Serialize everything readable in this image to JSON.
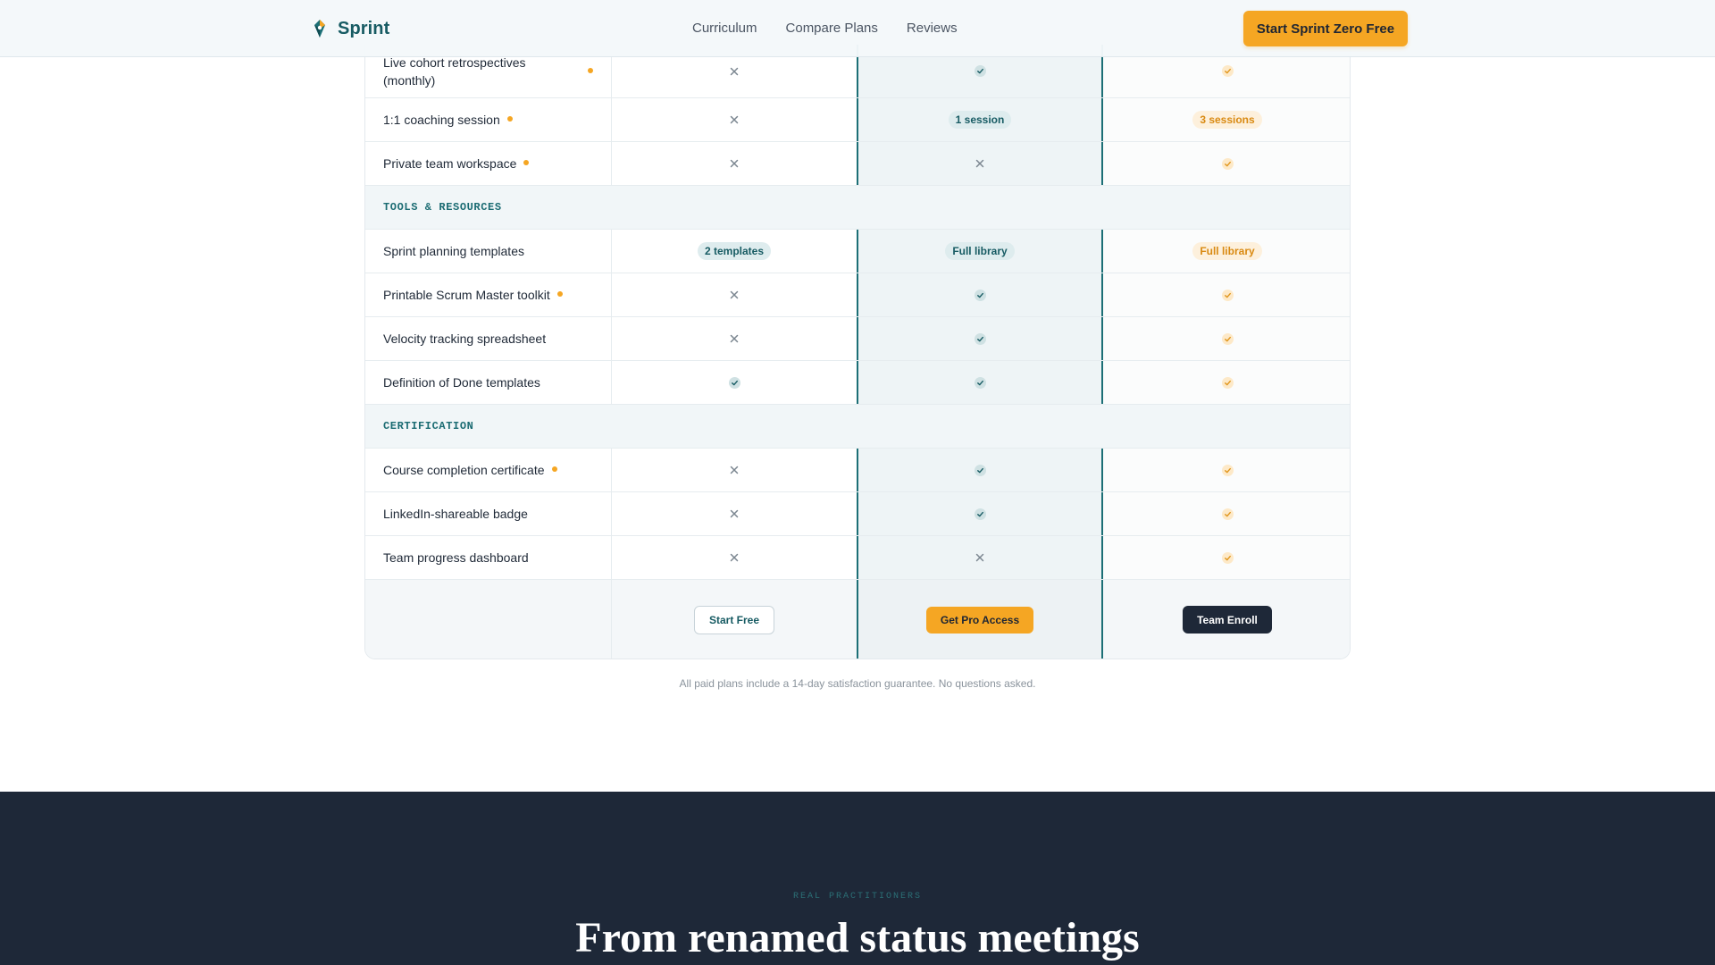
{
  "header": {
    "brand": "Sprint",
    "nav": [
      "Curriculum",
      "Compare Plans",
      "Reviews"
    ],
    "cta": "Start Sprint Zero Free"
  },
  "table": {
    "rows": [
      {
        "type": "feature",
        "label": "Live cohort retrospectives (monthly)",
        "highlight": true,
        "free": "x",
        "pro": "check",
        "team": "check"
      },
      {
        "type": "feature",
        "label": "1:1 coaching session",
        "highlight": true,
        "free": "x",
        "pro": "1 session",
        "team": "3 sessions"
      },
      {
        "type": "feature",
        "label": "Private team workspace",
        "highlight": true,
        "free": "x",
        "pro": "x",
        "team": "check"
      },
      {
        "type": "section",
        "label": "TOOLS & RESOURCES"
      },
      {
        "type": "feature",
        "label": "Sprint planning templates",
        "highlight": false,
        "free": "2 templates",
        "pro": "Full library",
        "team": "Full library"
      },
      {
        "type": "feature",
        "label": "Printable Scrum Master toolkit",
        "highlight": true,
        "free": "x",
        "pro": "check",
        "team": "check"
      },
      {
        "type": "feature",
        "label": "Velocity tracking spreadsheet",
        "highlight": false,
        "free": "x",
        "pro": "check",
        "team": "check"
      },
      {
        "type": "feature",
        "label": "Definition of Done templates",
        "highlight": false,
        "free": "check",
        "pro": "check",
        "team": "check"
      },
      {
        "type": "section",
        "label": "CERTIFICATION"
      },
      {
        "type": "feature",
        "label": "Course completion certificate",
        "highlight": true,
        "free": "x",
        "pro": "check",
        "team": "check"
      },
      {
        "type": "feature",
        "label": "LinkedIn-shareable badge",
        "highlight": false,
        "free": "x",
        "pro": "check",
        "team": "check"
      },
      {
        "type": "feature",
        "label": "Team progress dashboard",
        "highlight": false,
        "free": "x",
        "pro": "x",
        "team": "check"
      }
    ],
    "buttons": {
      "free": "Start Free",
      "pro": "Get Pro Access",
      "team": "Team Enroll"
    }
  },
  "guarantee": "All paid plans include a 14-day satisfaction guarantee. No questions asked.",
  "testimonials": {
    "eyebrow": "REAL PRACTITIONERS",
    "title": "From renamed status meetings"
  },
  "colors": {
    "teal": "#175b63",
    "amber": "#f5a623",
    "navy": "#1e2838"
  }
}
